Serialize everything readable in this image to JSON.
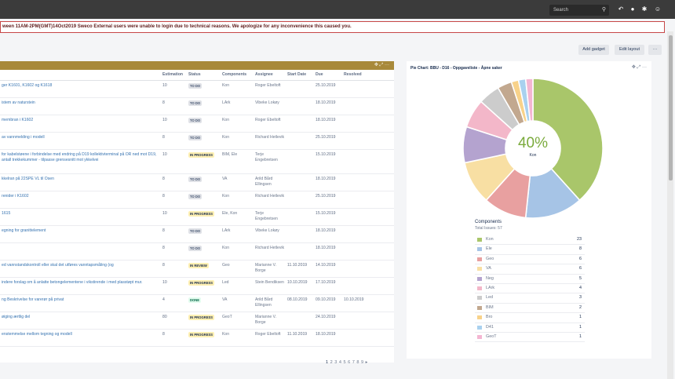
{
  "topbar": {
    "search_placeholder": "Search",
    "icons": [
      "search-icon",
      "arrow-icon",
      "help-icon",
      "settings-icon",
      "user-avatar"
    ]
  },
  "banner": {
    "text": "ween 11AM-2PM(GMT)14Oct2019 Sweco External users were unable to login due to technical reasons. We apologize for any inconvenience this caused you."
  },
  "toolbar": {
    "add_gadget": "Add gadget",
    "edit_layout": "Edit layout",
    "more": "···"
  },
  "issues_gadget": {
    "header_color": "#a8893a",
    "columns": [
      "",
      "Estimation",
      "Status",
      "Components",
      "Assignee",
      "Start Date",
      "Due",
      "Resolved"
    ],
    "rows": [
      {
        "summary": "ger K1601, K1602 og K1618",
        "estimation": "10",
        "status": "TO DO",
        "components": "Kon",
        "assignee": "Roger Ebeltoft",
        "start": "",
        "due": "25.10.2019",
        "resolved": ""
      },
      {
        "summary": "istem av naturstein",
        "estimation": "8",
        "status": "TO DO",
        "components": "LArk",
        "assignee": "Vibeke Lokøy",
        "start": "",
        "due": "18.10.2019",
        "resolved": ""
      },
      {
        "summary": "membran i K1602",
        "estimation": "10",
        "status": "TO DO",
        "components": "Kon",
        "assignee": "Roger Ebeltoft",
        "start": "",
        "due": "18.10.2019",
        "resolved": ""
      },
      {
        "summary": "av vannmelding i modell",
        "estimation": "8",
        "status": "TO DO",
        "components": "Kon",
        "assignee": "Richard Hetlevik",
        "start": "",
        "due": "25.10.2019",
        "resolved": ""
      },
      {
        "summary": "for kabelstøene i forbindelse med endring på D19 kollektivterminal på OR ned mot D19, antall trekkekummer - tilpasse grensesnitt mot ykkelvei",
        "estimation": "10",
        "status": "IN PROGRESS",
        "components": "BIM, Ele",
        "assignee": "Terje Engebretsen",
        "start": "",
        "due": "15.10.2019",
        "resolved": ""
      },
      {
        "summary": "kkelran på 22SPE VL til Osen",
        "estimation": "8",
        "status": "TO DO",
        "components": "VA",
        "assignee": "Arild Bård Ellingsen",
        "start": "",
        "due": "18.10.2019",
        "resolved": ""
      },
      {
        "summary": "renider i K1602",
        "estimation": "8",
        "status": "TO DO",
        "components": "Kon",
        "assignee": "Richard Hetlevik",
        "start": "",
        "due": "25.10.2019",
        "resolved": ""
      },
      {
        "summary": "1615",
        "estimation": "10",
        "status": "IN PROGRESS",
        "components": "Ele, Kon",
        "assignee": "Terje Engebretsen",
        "start": "",
        "due": "15.10.2019",
        "resolved": ""
      },
      {
        "summary": "egning for granittelement",
        "estimation": "8",
        "status": "TO DO",
        "components": "LArk",
        "assignee": "Vibeke Lokøy",
        "start": "",
        "due": "18.10.2019",
        "resolved": ""
      },
      {
        "summary": "",
        "estimation": "8",
        "status": "TO DO",
        "components": "Kon",
        "assignee": "Richard Hetlevik",
        "start": "",
        "due": "18.10.2019",
        "resolved": ""
      },
      {
        "summary": "ed vannstandskontroll eller skal det utføres vanntapsmåling (og",
        "estimation": "8",
        "status": "IN REVIEW",
        "components": "Geo",
        "assignee": "Marianne V. Borge",
        "start": "11.10.2019",
        "due": "14.10.2019",
        "resolved": ""
      },
      {
        "summary": "indere forslag om å anlatte betongelementene i vikstirende i med plasstøpt mur.",
        "estimation": "10",
        "status": "IN PROGRESS",
        "components": "Led",
        "assignee": "Stein Bendiksen",
        "start": "10.10.2019",
        "due": "17.10.2019",
        "resolved": ""
      },
      {
        "summary": "ng Beskrivelse for varerør på privat",
        "estimation": "4",
        "status": "DONE",
        "components": "VA",
        "assignee": "Arild Bård Ellingsen",
        "start": "08.10.2019",
        "due": "09.10.2019",
        "resolved": "10.10.2019"
      },
      {
        "summary": "øiging ærtlig del",
        "estimation": "80",
        "status": "IN PROGRESS",
        "components": "GeoT",
        "assignee": "Marianne V. Borge",
        "start": "",
        "due": "24.10.2019",
        "resolved": ""
      },
      {
        "summary": "enstemmelse mellom tegning og modell",
        "estimation": "8",
        "status": "IN PROGRESS",
        "components": "Kon",
        "assignee": "Roger Ebeltoft",
        "start": "11.10.2019",
        "due": "18.10.2019",
        "resolved": ""
      }
    ],
    "pagination": [
      "1",
      "2",
      "3",
      "4",
      "5",
      "6",
      "7",
      "8",
      "9",
      "▸"
    ]
  },
  "pie_gadget": {
    "title": "Pie Chart: BBU - D16 - Oppgaveliste - Åpne saker",
    "center_percent": "40%",
    "center_label": "Kon",
    "legend_title": "Components",
    "legend_sub": "Total Issues: 57"
  },
  "chart_data": {
    "type": "pie",
    "title": "Pie Chart: BBU - D16 - Oppgaveliste - Åpne saker",
    "total": 57,
    "slices": [
      {
        "name": "Kon",
        "value": 23,
        "color": "#a9c66a"
      },
      {
        "name": "Ele",
        "value": 8,
        "color": "#a6c4e6"
      },
      {
        "name": "Geo",
        "value": 6,
        "color": "#e8a0a0"
      },
      {
        "name": "VA",
        "value": 6,
        "color": "#f8dfa3"
      },
      {
        "name": "Neg",
        "value": 5,
        "color": "#b4a3cf"
      },
      {
        "name": "LArk",
        "value": 4,
        "color": "#f3b7c9"
      },
      {
        "name": "Led",
        "value": 3,
        "color": "#cccccc"
      },
      {
        "name": "BIM",
        "value": 2,
        "color": "#c2a88f"
      },
      {
        "name": "Bro",
        "value": 1,
        "color": "#f8d28a"
      },
      {
        "name": "D41",
        "value": 1,
        "color": "#a9d1ef"
      },
      {
        "name": "GeoT",
        "value": 1,
        "color": "#f4b6d2"
      }
    ]
  }
}
